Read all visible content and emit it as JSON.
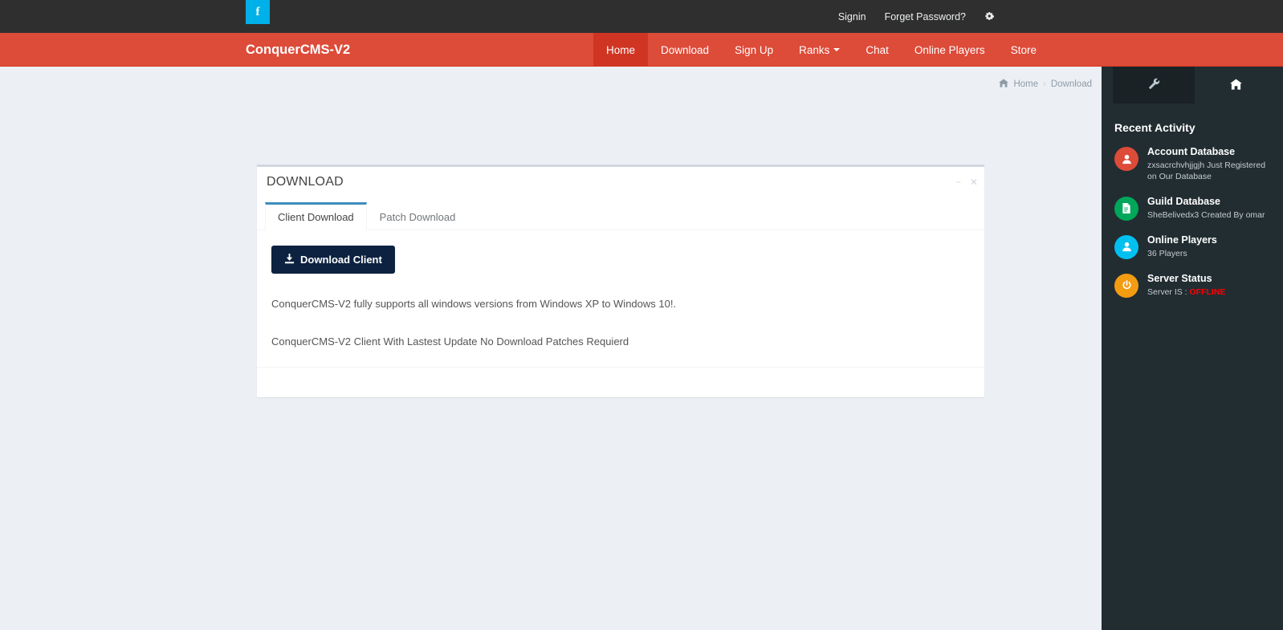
{
  "topbar": {
    "social_icon": "facebook-icon",
    "social_glyph": "f",
    "links": [
      {
        "label": "Signin",
        "name": "signin-link"
      },
      {
        "label": "Forget Password?",
        "name": "forget-password-link"
      }
    ],
    "settings_icon": "cogs-icon",
    "settings_glyph": "⚙"
  },
  "navbar": {
    "brand": "ConquerCMS-V2",
    "items": [
      {
        "label": "Home",
        "active": true,
        "caret": false
      },
      {
        "label": "Download",
        "active": false,
        "caret": false
      },
      {
        "label": "Sign Up",
        "active": false,
        "caret": false
      },
      {
        "label": "Ranks",
        "active": false,
        "caret": true
      },
      {
        "label": "Chat",
        "active": false,
        "caret": false
      },
      {
        "label": "Online Players",
        "active": false,
        "caret": false
      },
      {
        "label": "Store",
        "active": false,
        "caret": false
      }
    ],
    "bg_color": "#dd4b39",
    "active_bg_color": "#d03524"
  },
  "breadcrumb": {
    "home_icon": "home-icon",
    "home_glyph": "⌂",
    "home_label": "Home",
    "separator": "›",
    "current": "Download"
  },
  "box": {
    "title": "DOWNLOAD",
    "collapse_label": "−",
    "close_label": "✕",
    "tabs": [
      {
        "label": "Client Download",
        "active": true
      },
      {
        "label": "Patch Download",
        "active": false
      }
    ],
    "download_button": {
      "label": "Download Client",
      "icon": "download-icon",
      "icon_glyph": "⤓",
      "bg_color": "#0d2240"
    },
    "paragraph_1": "ConquerCMS-V2 fully supports all windows versions from Windows XP to Windows 10!.",
    "paragraph_2": "ConquerCMS-V2 Client With Lastest Update No Download Patches Requierd"
  },
  "sidebar": {
    "tabs": [
      {
        "icon": "wrench-icon",
        "glyph": "🔧",
        "active": true
      },
      {
        "icon": "home-icon",
        "glyph": "🏠",
        "active": false
      }
    ],
    "heading": "Recent Activity",
    "activities": [
      {
        "title": "Account Database",
        "desc": "zxsacrchvhjjgjh Just Registered on Our Database",
        "icon": "user-icon",
        "glyph": "👤",
        "color": "#dd4b39"
      },
      {
        "title": "Guild Database",
        "desc": "SheBelivedx3 Created By omar",
        "icon": "file-text-icon",
        "glyph": "🗎",
        "color": "#00a65a"
      },
      {
        "title": "Online Players",
        "desc": "36 Players",
        "icon": "user-icon",
        "glyph": "👤",
        "color": "#00c0ef"
      },
      {
        "title": "Server Status",
        "desc_prefix": "Server IS : ",
        "desc_status": "OFFLINE",
        "icon": "power-icon",
        "glyph": "⏻",
        "color": "#f39c12",
        "status_color": "#ff0000"
      }
    ]
  }
}
